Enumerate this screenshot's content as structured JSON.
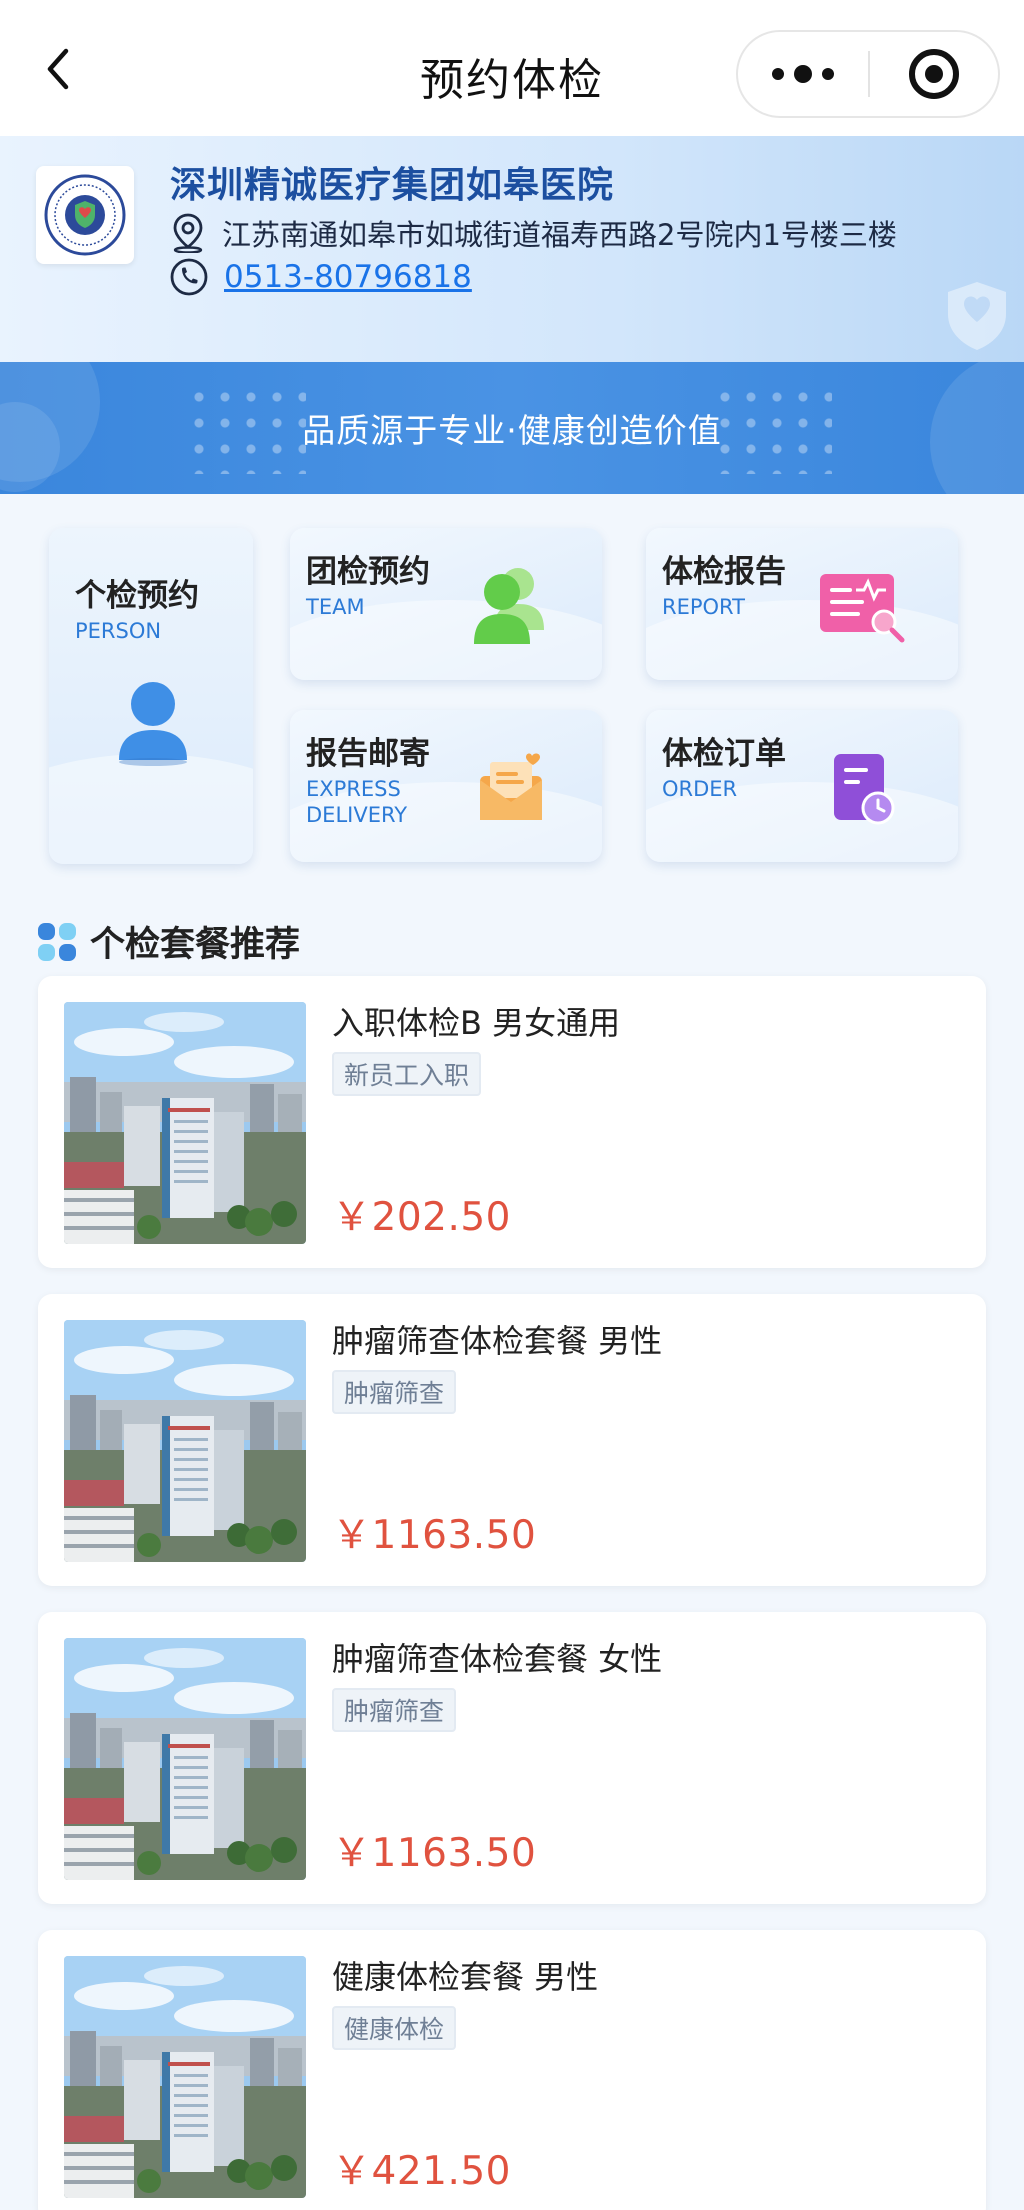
{
  "nav": {
    "title": "预约体检"
  },
  "hospital": {
    "name": "深圳精诚医疗集团如皋医院",
    "address": "江苏南通如皋市如城街道福寿西路2号院内1号楼三楼",
    "phone": "0513-80796818"
  },
  "banner": {
    "slogan": "品质源于专业·健康创造价值"
  },
  "services": [
    {
      "title": "个检预约",
      "subtitle": "PERSON",
      "icon": "person-icon",
      "color": "#3f8fe6"
    },
    {
      "title": "团检预约",
      "subtitle": "TEAM",
      "icon": "team-icon",
      "color": "#66cc55"
    },
    {
      "title": "体检报告",
      "subtitle": "REPORT",
      "icon": "report-icon",
      "color": "#f05ca0"
    },
    {
      "title": "报告邮寄",
      "subtitle": "EXPRESS DELIVERY",
      "icon": "mail-icon",
      "color": "#f5a74a"
    },
    {
      "title": "体检订单",
      "subtitle": "ORDER",
      "icon": "order-icon",
      "color": "#8f4fd8"
    }
  ],
  "recommend": {
    "title": "个检套餐推荐",
    "packages": [
      {
        "name": "入职体检B 男女通用",
        "tag": "新员工入职",
        "price": "￥202.50"
      },
      {
        "name": "肿瘤筛查体检套餐 男性",
        "tag": "肿瘤筛查",
        "price": "￥1163.50"
      },
      {
        "name": "肿瘤筛查体检套餐 女性",
        "tag": "肿瘤筛查",
        "price": "￥1163.50"
      },
      {
        "name": "健康体检套餐 男性",
        "tag": "健康体检",
        "price": "￥421.50"
      }
    ]
  },
  "colors": {
    "brand_blue": "#3a86dc",
    "price_red": "#e0523f",
    "title_blue": "#1c4fa0"
  }
}
